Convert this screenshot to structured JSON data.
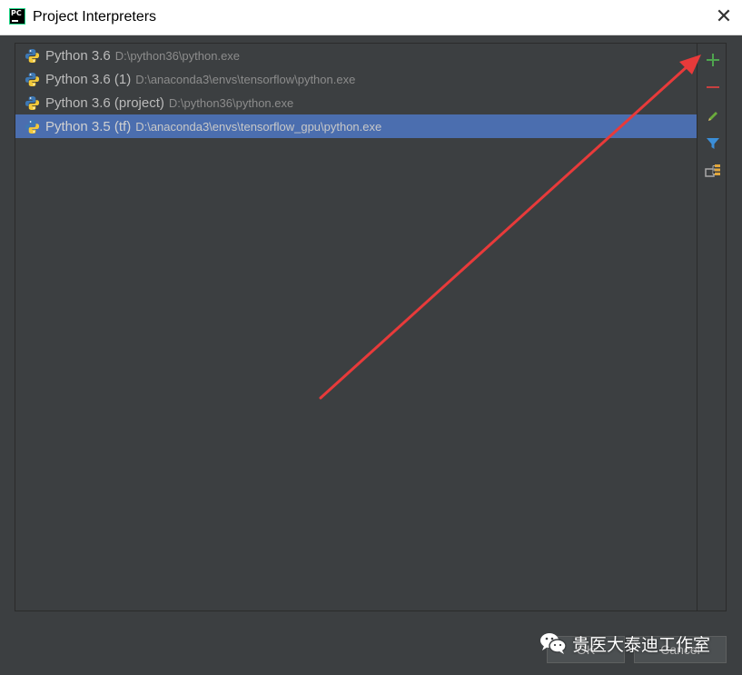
{
  "window": {
    "title": "Project Interpreters",
    "app_icon_text": "PC",
    "close_glyph": "✕"
  },
  "interpreters": [
    {
      "name": "Python 3.6",
      "path": "D:\\python36\\python.exe",
      "selected": false
    },
    {
      "name": "Python 3.6 (1)",
      "path": "D:\\anaconda3\\envs\\tensorflow\\python.exe",
      "selected": false
    },
    {
      "name": "Python 3.6 (project)",
      "path": "D:\\python36\\python.exe",
      "selected": false
    },
    {
      "name": "Python 3.5 (tf)",
      "path": "D:\\anaconda3\\envs\\tensorflow_gpu\\python.exe",
      "selected": true
    }
  ],
  "toolbar": {
    "add_icon": "plus-icon",
    "remove_icon": "minus-icon",
    "edit_icon": "pencil-icon",
    "filter_icon": "filter-icon",
    "paths_icon": "tree-icon"
  },
  "footer": {
    "ok_label": "OK",
    "cancel_label": "Cancel"
  },
  "watermark": {
    "text": "贵医大泰迪工作室"
  },
  "colors": {
    "background": "#3c3f41",
    "selection": "#4b6eaf",
    "add": "#4ea44e",
    "remove": "#c74040",
    "annotation_arrow": "#e83a3a"
  }
}
